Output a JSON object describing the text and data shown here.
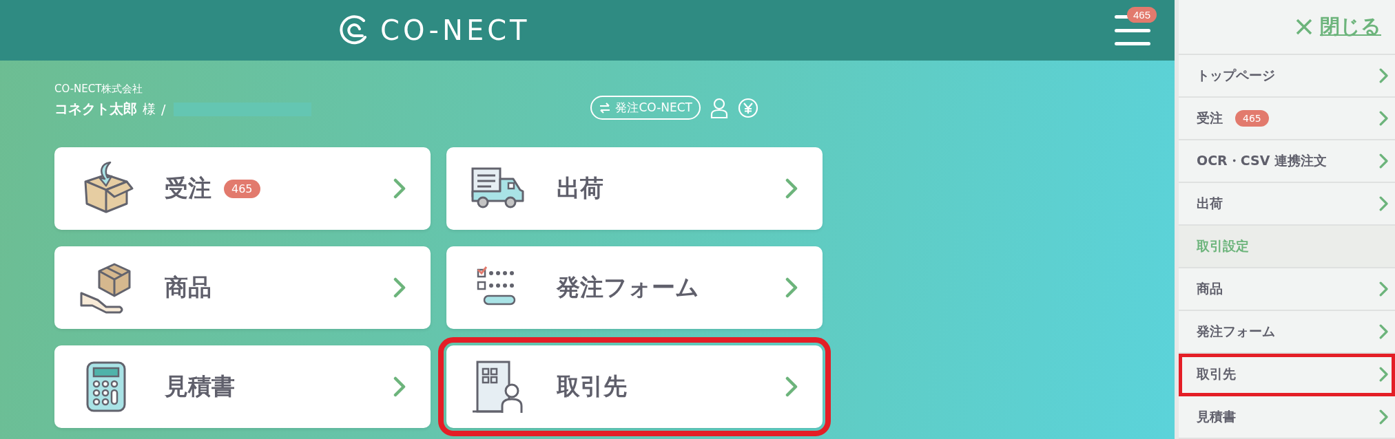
{
  "header": {
    "logo": "CO-NECT",
    "notification_count": "465"
  },
  "account": {
    "company": "CO-NECT株式会社",
    "user_name": "コネクト太郎",
    "honorific": "様",
    "separator": "/",
    "name_redacted": true,
    "switch_button": "発注CO-NECT"
  },
  "cards": [
    {
      "label": "受注",
      "badge": "465",
      "kind": "box",
      "highlighted": false
    },
    {
      "label": "出荷",
      "kind": "truck",
      "highlighted": false
    },
    {
      "label": "商品",
      "kind": "hand",
      "highlighted": false
    },
    {
      "label": "発注フォーム",
      "kind": "form",
      "highlighted": false
    },
    {
      "label": "見積書",
      "kind": "calculator",
      "highlighted": false
    },
    {
      "label": "取引先",
      "kind": "building",
      "highlighted": true
    }
  ],
  "sidebar": {
    "close_label": "閉じる",
    "items": [
      {
        "kind": "link",
        "label": "トップページ",
        "highlighted": false
      },
      {
        "kind": "link",
        "label": "受注",
        "badge": "465",
        "highlighted": false
      },
      {
        "kind": "link",
        "label": "OCR・CSV 連携注文",
        "highlighted": false
      },
      {
        "kind": "link",
        "label": "出荷",
        "highlighted": false
      },
      {
        "kind": "section",
        "label": "取引設定"
      },
      {
        "kind": "link",
        "label": "商品",
        "highlighted": false
      },
      {
        "kind": "link",
        "label": "発注フォーム",
        "highlighted": false
      },
      {
        "kind": "link",
        "label": "取引先",
        "highlighted": true
      },
      {
        "kind": "link",
        "label": "見積書",
        "highlighted": false
      }
    ]
  }
}
